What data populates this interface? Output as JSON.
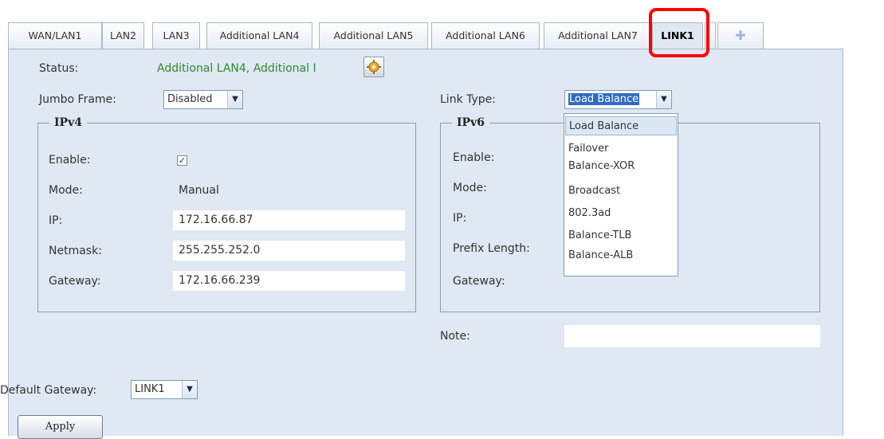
{
  "tabs": [
    {
      "label": "WAN/LAN1"
    },
    {
      "label": "LAN2"
    },
    {
      "label": "LAN3"
    },
    {
      "label": "Additional LAN4"
    },
    {
      "label": "Additional LAN5"
    },
    {
      "label": "Additional LAN6"
    },
    {
      "label": "Additional LAN7"
    },
    {
      "label": "LINK1",
      "active": true
    }
  ],
  "add_tab_icon": "plus-icon",
  "status": {
    "label": "Status:",
    "value": "Additional LAN4, Additional I",
    "button_icon": "gear-settings-icon"
  },
  "jumbo_frame": {
    "label": "Jumbo Frame:",
    "value": "Disabled"
  },
  "link_type": {
    "label": "Link Type:",
    "value": "Load Balance",
    "options": [
      "Load Balance",
      "Failover",
      "Balance-XOR",
      "Broadcast",
      "802.3ad",
      "Balance-TLB",
      "Balance-ALB"
    ]
  },
  "ipv4": {
    "legend": "IPv4",
    "enable_label": "Enable:",
    "enabled": true,
    "mode_label": "Mode:",
    "mode_value": "Manual",
    "ip_label": "IP:",
    "ip_value": "172.16.66.87",
    "netmask_label": "Netmask:",
    "netmask_value": "255.255.252.0",
    "gateway_label": "Gateway:",
    "gateway_value": "172.16.66.239"
  },
  "ipv6": {
    "legend": "IPv6",
    "enable_label": "Enable:",
    "mode_label": "Mode:",
    "ip_label": "IP:",
    "prefix_label": "Prefix Length:",
    "gateway_label": "Gateway:"
  },
  "note": {
    "label": "Note:",
    "value": ""
  },
  "default_gateway": {
    "label": "Default Gateway:",
    "value": "LINK1"
  },
  "apply_label": "Apply",
  "colors": {
    "panel_bg": "#dfe8f3",
    "status_text": "#2e8b2e",
    "highlight": "#ff0000"
  }
}
